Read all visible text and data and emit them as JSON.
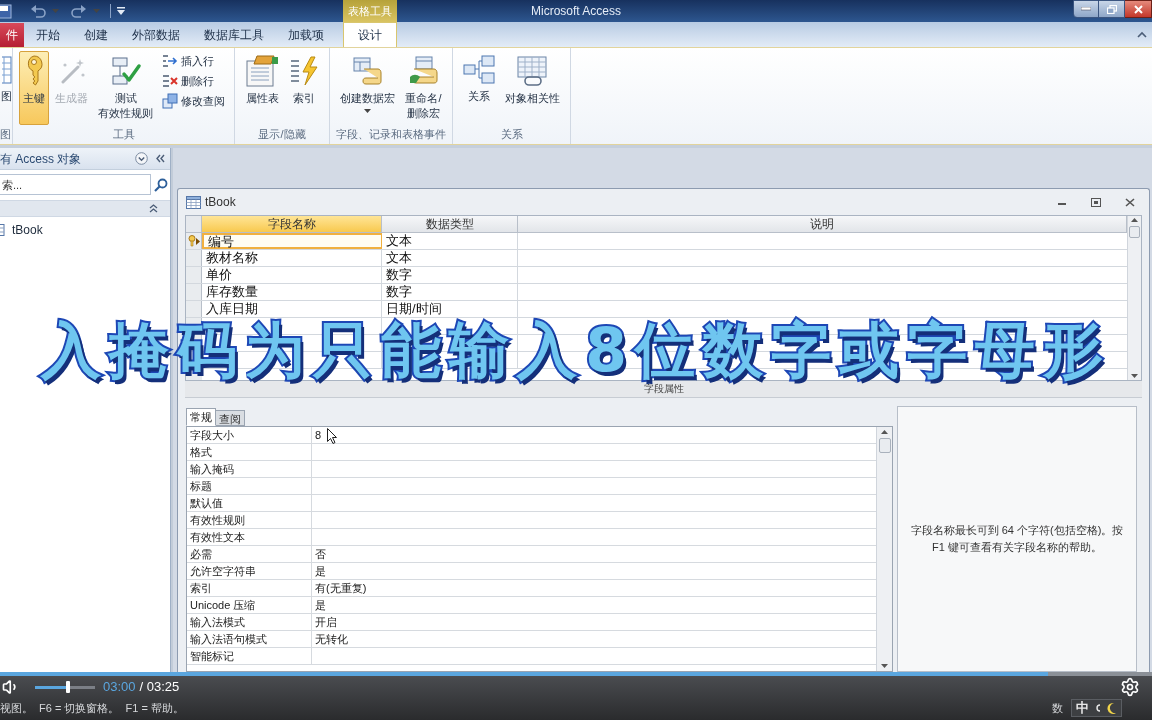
{
  "window": {
    "title": "Microsoft Access",
    "context_tab_group": "表格工具"
  },
  "ribbon_tabs": [
    {
      "label": "件",
      "kind": "file",
      "selected": false
    },
    {
      "label": "开始",
      "kind": "standard",
      "selected": false
    },
    {
      "label": "创建",
      "kind": "standard",
      "selected": false
    },
    {
      "label": "外部数据",
      "kind": "standard",
      "selected": false
    },
    {
      "label": "数据库工具",
      "kind": "standard",
      "selected": false
    },
    {
      "label": "加载项",
      "kind": "standard",
      "selected": false
    },
    {
      "label": "设计",
      "kind": "context",
      "selected": true
    }
  ],
  "ribbon_groups": [
    {
      "label": "图",
      "buttons": [
        {
          "kind": "large",
          "lines": [
            "图"
          ],
          "pressed": false,
          "disabled": false,
          "dropdown": false
        }
      ]
    },
    {
      "label": "工具",
      "buttons": [
        {
          "kind": "large",
          "lines": [
            "主键"
          ],
          "pressed": true,
          "disabled": false,
          "dropdown": false
        },
        {
          "kind": "large",
          "lines": [
            "生成器"
          ],
          "pressed": false,
          "disabled": true,
          "dropdown": false
        },
        {
          "kind": "large",
          "lines": [
            "测试",
            "有效性规则"
          ],
          "pressed": false,
          "disabled": false,
          "dropdown": false
        },
        {
          "kind": "small",
          "lines": [
            "插入行"
          ],
          "pressed": false,
          "disabled": false,
          "dropdown": false
        },
        {
          "kind": "small",
          "lines": [
            "删除行"
          ],
          "pressed": false,
          "disabled": false,
          "dropdown": false
        },
        {
          "kind": "small",
          "lines": [
            "修改查阅"
          ],
          "pressed": false,
          "disabled": false,
          "dropdown": false
        }
      ]
    },
    {
      "label": "显示/隐藏",
      "buttons": [
        {
          "kind": "large",
          "lines": [
            "属性表"
          ],
          "pressed": false,
          "disabled": false,
          "dropdown": false
        },
        {
          "kind": "large",
          "lines": [
            "索引"
          ],
          "pressed": false,
          "disabled": false,
          "dropdown": false
        }
      ]
    },
    {
      "label": "字段、记录和表格事件",
      "buttons": [
        {
          "kind": "large",
          "lines": [
            "创建数据宏"
          ],
          "pressed": false,
          "disabled": false,
          "dropdown": true
        },
        {
          "kind": "large",
          "lines": [
            "重命名/",
            "删除宏"
          ],
          "pressed": false,
          "disabled": false,
          "dropdown": false
        }
      ]
    },
    {
      "label": "关系",
      "buttons": [
        {
          "kind": "large",
          "lines": [
            "关系"
          ],
          "pressed": false,
          "disabled": false,
          "dropdown": false
        },
        {
          "kind": "large",
          "lines": [
            "对象相关性"
          ],
          "pressed": false,
          "disabled": false,
          "dropdown": false
        }
      ]
    }
  ],
  "navigation_pane": {
    "title": "有 Access 对象",
    "search": {
      "placeholder": "索..."
    },
    "groups": [
      {
        "expanded": true,
        "items": [
          {
            "label": "tBook"
          }
        ]
      }
    ]
  },
  "document": {
    "title": "tBook"
  },
  "design_table": {
    "columns": [
      {
        "label": "字段名称",
        "highlighted": true
      },
      {
        "label": "数据类型",
        "highlighted": false
      },
      {
        "label": "说明",
        "highlighted": false
      }
    ],
    "rows": [
      {
        "field_name": "编号",
        "data_type": "文本",
        "primary_key": true,
        "selected": true
      },
      {
        "field_name": "教材名称",
        "data_type": "文本",
        "primary_key": false,
        "selected": false
      },
      {
        "field_name": "单价",
        "data_type": "数字",
        "primary_key": false,
        "selected": false
      },
      {
        "field_name": "库存数量",
        "data_type": "数字",
        "primary_key": false,
        "selected": false
      },
      {
        "field_name": "入库日期",
        "data_type": "日期/时间",
        "primary_key": false,
        "selected": false
      }
    ]
  },
  "field_properties_label": "字段属性",
  "property_tabs": [
    {
      "label": "常规",
      "selected": true
    },
    {
      "label": "查阅",
      "selected": false
    }
  ],
  "properties": [
    {
      "label": "字段大小",
      "value": "8"
    },
    {
      "label": "格式"
    },
    {
      "label": "输入掩码"
    },
    {
      "label": "标题"
    },
    {
      "label": "默认值"
    },
    {
      "label": "有效性规则"
    },
    {
      "label": "有效性文本"
    },
    {
      "label": "必需",
      "value": "否"
    },
    {
      "label": "允许空字符串",
      "value": "是"
    },
    {
      "label": "索引",
      "value": "有(无重复)"
    },
    {
      "label": "Unicode 压缩",
      "value": "是"
    },
    {
      "label": "输入法模式",
      "value": "开启"
    },
    {
      "label": "输入法语句模式",
      "value": "无转化"
    },
    {
      "label": "智能标记"
    }
  ],
  "help_text": "字段名称最长可到 64 个字符(包括空格)。按 F1 键可查看有关字段名称的帮助。",
  "status_bar": {
    "text": "视图。  F6 = 切换窗格。  F1 = 帮助。",
    "indicator": "数"
  },
  "ime": {
    "mode": "中"
  },
  "video_player": {
    "progress": {
      "level": 0.91
    },
    "volume": {
      "level": 0.55
    },
    "current_time": "03:00",
    "duration": "/ 03:25"
  },
  "caption": {
    "text": "入掩码为只能输入8位数字或字母形"
  }
}
